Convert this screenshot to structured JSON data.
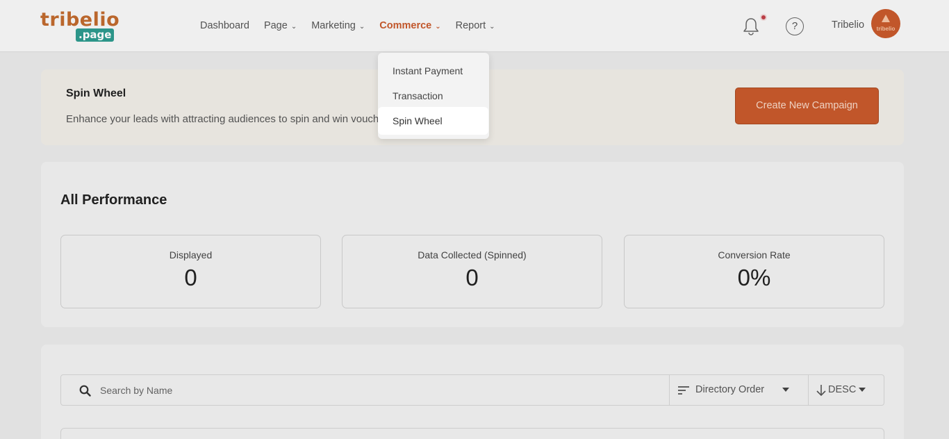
{
  "header": {
    "logo_top": "tribelio",
    "logo_bottom": ".page",
    "nav": [
      {
        "label": "Dashboard",
        "has_chevron": false,
        "active": false
      },
      {
        "label": "Page",
        "has_chevron": true,
        "active": false
      },
      {
        "label": "Marketing",
        "has_chevron": true,
        "active": false
      },
      {
        "label": "Commerce",
        "has_chevron": true,
        "active": true
      },
      {
        "label": "Report",
        "has_chevron": true,
        "active": false
      }
    ],
    "help_label": "?",
    "user_name": "Tribelio",
    "avatar_text": "tribelio"
  },
  "dropdown": {
    "items": [
      "Instant Payment",
      "Transaction",
      "Spin Wheel"
    ],
    "highlighted": "Spin Wheel"
  },
  "spin_card": {
    "title": "Spin Wheel",
    "description": "Enhance your leads with attracting audiences to spin and win voucher",
    "create_button": "Create New Campaign"
  },
  "performance": {
    "title": "All Performance",
    "stats": [
      {
        "label": "Displayed",
        "value": "0"
      },
      {
        "label": "Data Collected (Spinned)",
        "value": "0"
      },
      {
        "label": "Conversion Rate",
        "value": "0%"
      }
    ]
  },
  "list": {
    "search_placeholder": "Search by Name",
    "sort_label": "Directory Order",
    "order_label": "DESC"
  },
  "colors": {
    "accent": "#c8592c",
    "logo_teal": "#2e9a8e",
    "notification_dot": "#c14049"
  }
}
